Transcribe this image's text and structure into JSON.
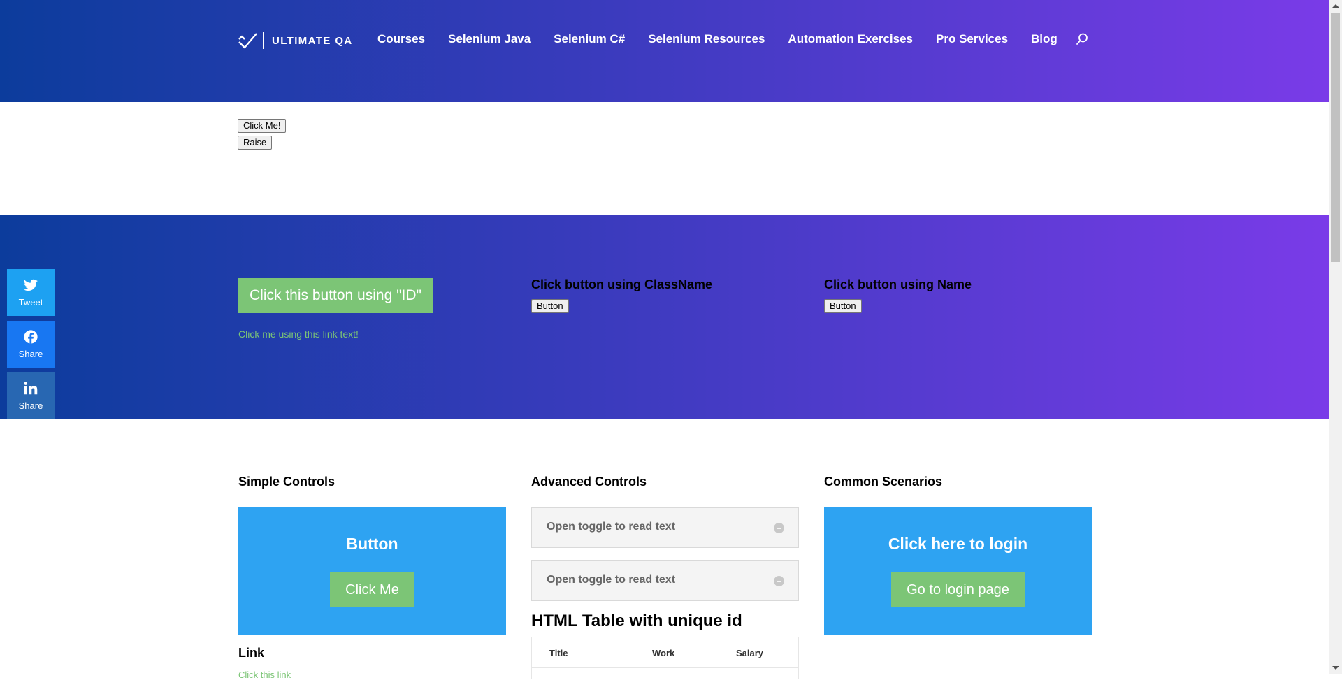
{
  "header": {
    "logo_text": "ULTIMATE QA",
    "nav": [
      "Courses",
      "Selenium Java",
      "Selenium C#",
      "Selenium Resources",
      "Automation Exercises",
      "Pro Services",
      "Blog"
    ],
    "search_icon": "search-icon"
  },
  "top_buttons": {
    "click_me": "Click Me!",
    "raise": "Raise"
  },
  "band": {
    "id_button": "Click this button using \"ID\"",
    "link_text": "Click me using this link text!",
    "classname_heading": "Click button using ClassName",
    "classname_button": "Button",
    "name_heading": "Click button using Name",
    "name_button": "Button"
  },
  "share": [
    {
      "label": "Tweet",
      "icon": "twitter-icon"
    },
    {
      "label": "Share",
      "icon": "facebook-icon"
    },
    {
      "label": "Share",
      "icon": "linkedin-icon"
    }
  ],
  "simple_controls": {
    "title": "Simple Controls",
    "card_title": "Button",
    "card_button": "Click Me",
    "link_heading": "Link",
    "link_text": "Click this link"
  },
  "advanced_controls": {
    "title": "Advanced Controls",
    "toggles": [
      "Open toggle to read text",
      "Open toggle to read text"
    ],
    "table_heading": "HTML Table with unique id",
    "table_columns": [
      "Title",
      "Work",
      "Salary"
    ]
  },
  "common_scenarios": {
    "title": "Common Scenarios",
    "card_title": "Click here to login",
    "card_button": "Go to login page"
  },
  "colors": {
    "gradient_start": "#0c3c9c",
    "gradient_end": "#7a3be8",
    "green_button": "#7cc576",
    "blue_card": "#2ea3f2",
    "twitter": "#1da1f2",
    "facebook": "#1877f2",
    "linkedin": "#2867b2"
  }
}
